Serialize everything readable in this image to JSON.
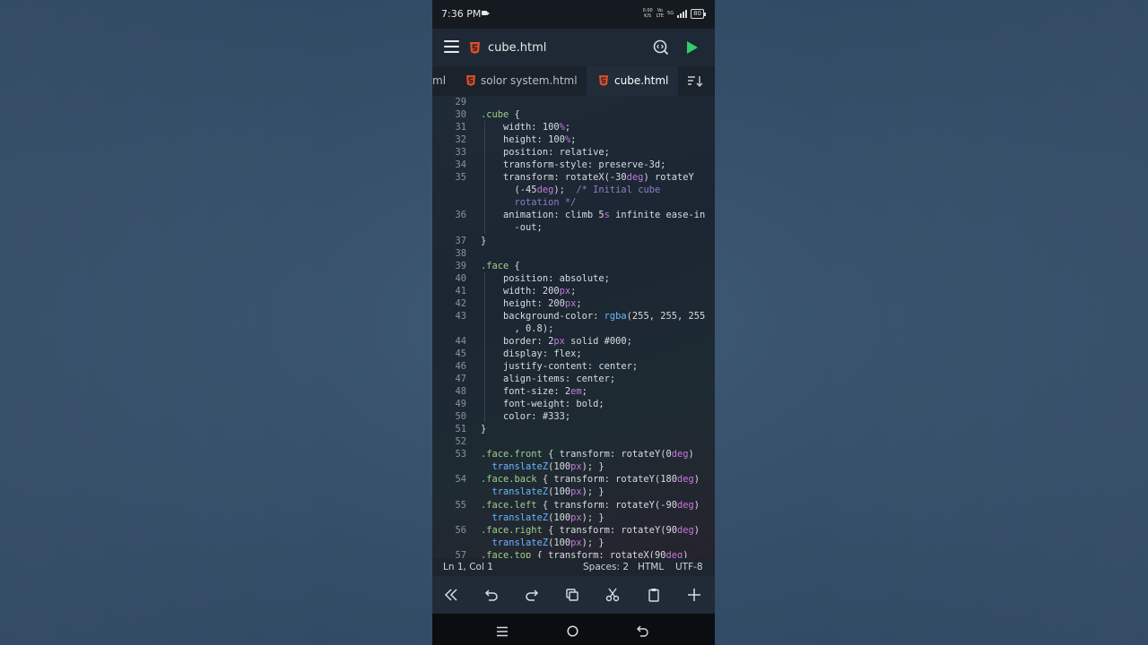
{
  "status_bar": {
    "time": "7:36 PM",
    "net_speed_top": "0.00",
    "net_speed_bottom": "K/S",
    "volte_top": "Vo",
    "volte_bottom": "LTE",
    "network": "5G",
    "battery": "80"
  },
  "header": {
    "file_title": "cube.html"
  },
  "tabs": [
    {
      "label": "ml",
      "active": false
    },
    {
      "label": "solor system.html",
      "active": false
    },
    {
      "label": "cube.html",
      "active": true
    }
  ],
  "code_lines": [
    {
      "n": "29",
      "t": ""
    },
    {
      "n": "30",
      "t": ".cube {"
    },
    {
      "n": "31",
      "t": "    width: 100%;"
    },
    {
      "n": "32",
      "t": "    height: 100%;"
    },
    {
      "n": "33",
      "t": "    position: relative;"
    },
    {
      "n": "34",
      "t": "    transform-style: preserve-3d;"
    },
    {
      "n": "35",
      "t": "    transform: rotateX(-30deg) rotateY"
    },
    {
      "n": "",
      "t": "      (-45deg);  /* Initial cube"
    },
    {
      "n": "",
      "t": "      rotation */"
    },
    {
      "n": "36",
      "t": "    animation: climb 5s infinite ease-in"
    },
    {
      "n": "",
      "t": "      -out;"
    },
    {
      "n": "37",
      "t": "}"
    },
    {
      "n": "38",
      "t": ""
    },
    {
      "n": "39",
      "t": ".face {"
    },
    {
      "n": "40",
      "t": "    position: absolute;"
    },
    {
      "n": "41",
      "t": "    width: 200px;"
    },
    {
      "n": "42",
      "t": "    height: 200px;"
    },
    {
      "n": "43",
      "t": "    background-color: rgba(255, 255, 255"
    },
    {
      "n": "",
      "t": "      , 0.8);"
    },
    {
      "n": "44",
      "t": "    border: 2px solid #000;"
    },
    {
      "n": "45",
      "t": "    display: flex;"
    },
    {
      "n": "46",
      "t": "    justify-content: center;"
    },
    {
      "n": "47",
      "t": "    align-items: center;"
    },
    {
      "n": "48",
      "t": "    font-size: 2em;"
    },
    {
      "n": "49",
      "t": "    font-weight: bold;"
    },
    {
      "n": "50",
      "t": "    color: #333;"
    },
    {
      "n": "51",
      "t": "}"
    },
    {
      "n": "52",
      "t": ""
    },
    {
      "n": "53",
      "t": ".face.front { transform: rotateY(0deg)"
    },
    {
      "n": "",
      "t": "  translateZ(100px); }"
    },
    {
      "n": "54",
      "t": ".face.back { transform: rotateY(180deg)"
    },
    {
      "n": "",
      "t": "  translateZ(100px); }"
    },
    {
      "n": "55",
      "t": ".face.left { transform: rotateY(-90deg)"
    },
    {
      "n": "",
      "t": "  translateZ(100px); }"
    },
    {
      "n": "56",
      "t": ".face.right { transform: rotateY(90deg)"
    },
    {
      "n": "",
      "t": "  translateZ(100px); }"
    },
    {
      "n": "57",
      "t": ".face.top { transform: rotateX(90deg)"
    }
  ],
  "editor_status": {
    "cursor": "Ln 1, Col 1",
    "spaces": "Spaces: 2",
    "language": "HTML",
    "encoding": "UTF-8"
  },
  "colors": {
    "html5_icon": "#e44d26",
    "run_button": "#2fd06a",
    "selector": "#9fd08a",
    "unit": "#c678dd",
    "function": "#6cb6ff",
    "comment": "#8b7fc7"
  },
  "icons": {
    "toolbar": [
      "double-chevron-left-icon",
      "undo-icon",
      "redo-icon",
      "copy-icon",
      "cut-icon",
      "paste-icon",
      "plus-icon"
    ],
    "navbar": [
      "recents-icon",
      "home-icon",
      "back-icon"
    ]
  }
}
